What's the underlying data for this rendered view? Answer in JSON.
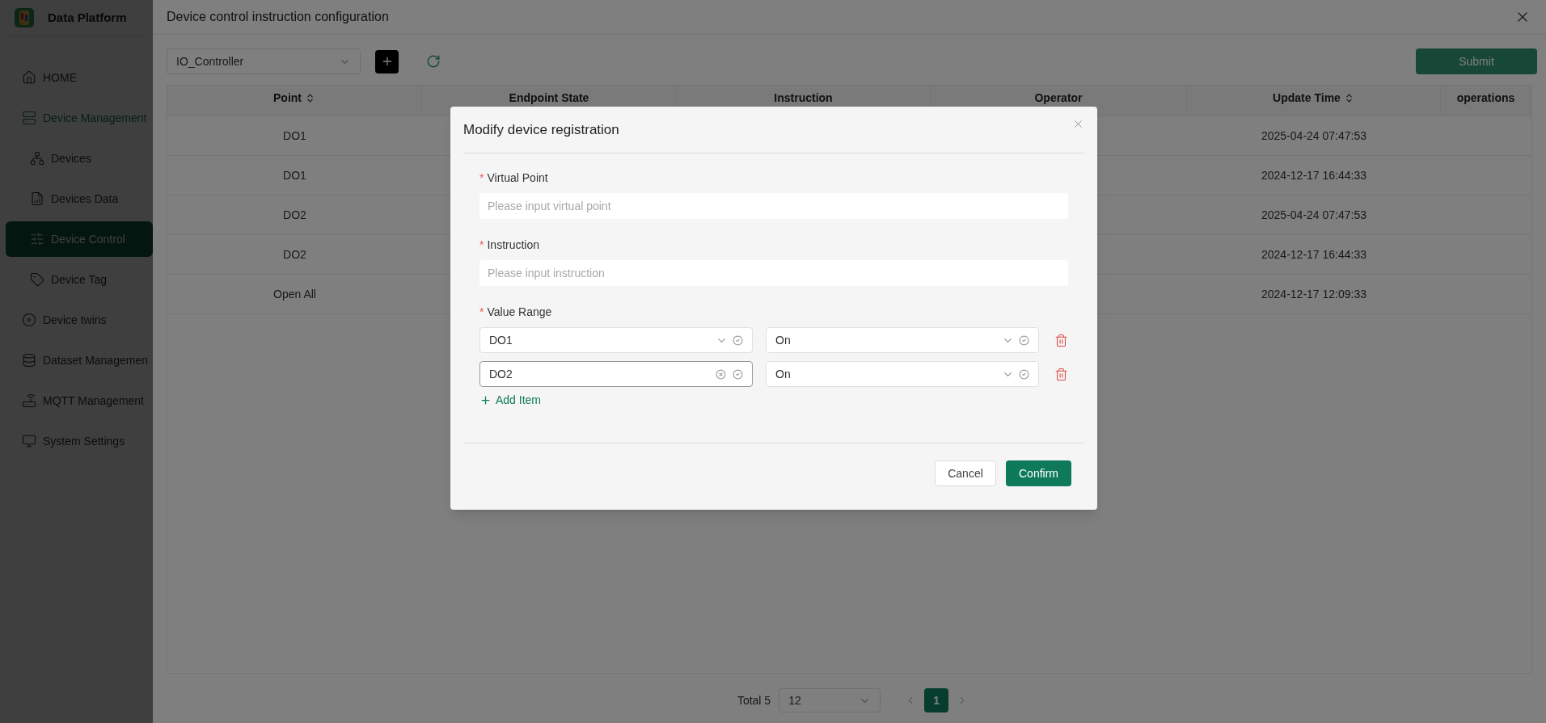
{
  "app": {
    "title": "Data Platform"
  },
  "sidebar": {
    "items": [
      {
        "label": "HOME",
        "selected": false
      },
      {
        "label": "Device Management",
        "selected": false,
        "expanded": true,
        "children": [
          {
            "label": "Devices",
            "selected": false
          },
          {
            "label": "Devices Data",
            "selected": false
          },
          {
            "label": "Device Control",
            "selected": true
          },
          {
            "label": "Device Tag",
            "selected": false
          }
        ]
      },
      {
        "label": "Device twins",
        "selected": false
      },
      {
        "label": "Dataset Managemen",
        "selected": false
      },
      {
        "label": "MQTT Management",
        "selected": false
      },
      {
        "label": "System Settings",
        "selected": false
      }
    ]
  },
  "drawer": {
    "title": "Device control instruction configuration",
    "device_select": {
      "value": "IO_Controller"
    },
    "submit": "Submit",
    "table": {
      "columns": [
        {
          "label": "Point",
          "sortable": true
        },
        {
          "label": "Endpoint State",
          "sortable": false
        },
        {
          "label": "Instruction",
          "sortable": false
        },
        {
          "label": "Operator",
          "sortable": false
        },
        {
          "label": "Update Time",
          "sortable": true
        },
        {
          "label": "operations",
          "sortable": false
        }
      ],
      "rows": [
        {
          "point": "DO1",
          "update_time": "2025-04-24 07:47:53"
        },
        {
          "point": "DO1",
          "update_time": "2024-12-17 16:44:33"
        },
        {
          "point": "DO2",
          "update_time": "2025-04-24 07:47:53"
        },
        {
          "point": "DO2",
          "update_time": "2024-12-17 16:44:33"
        },
        {
          "point": "Open All",
          "update_time": "2024-12-17 12:09:33"
        }
      ]
    },
    "pagination": {
      "total": "Total 5",
      "page_size": "12",
      "pages": [
        {
          "label": "1",
          "selected": true
        }
      ]
    }
  },
  "dialog": {
    "title": "Modify device registration",
    "fields": [
      {
        "label": "Virtual Point",
        "required_mark": "*",
        "placeholder": "Please input virtual point"
      },
      {
        "label": "Instruction",
        "required_mark": "*",
        "placeholder": "Please input instruction"
      }
    ],
    "value_range": {
      "label": "Value Range",
      "required_mark": "*",
      "rows": [
        {
          "point": "DO1",
          "state": "On",
          "hovered": false
        },
        {
          "point": "DO2",
          "state": "On",
          "hovered": true
        }
      ]
    },
    "add_item": "Add Item",
    "buttons": {
      "cancel": "Cancel",
      "confirm": "Confirm"
    }
  }
}
